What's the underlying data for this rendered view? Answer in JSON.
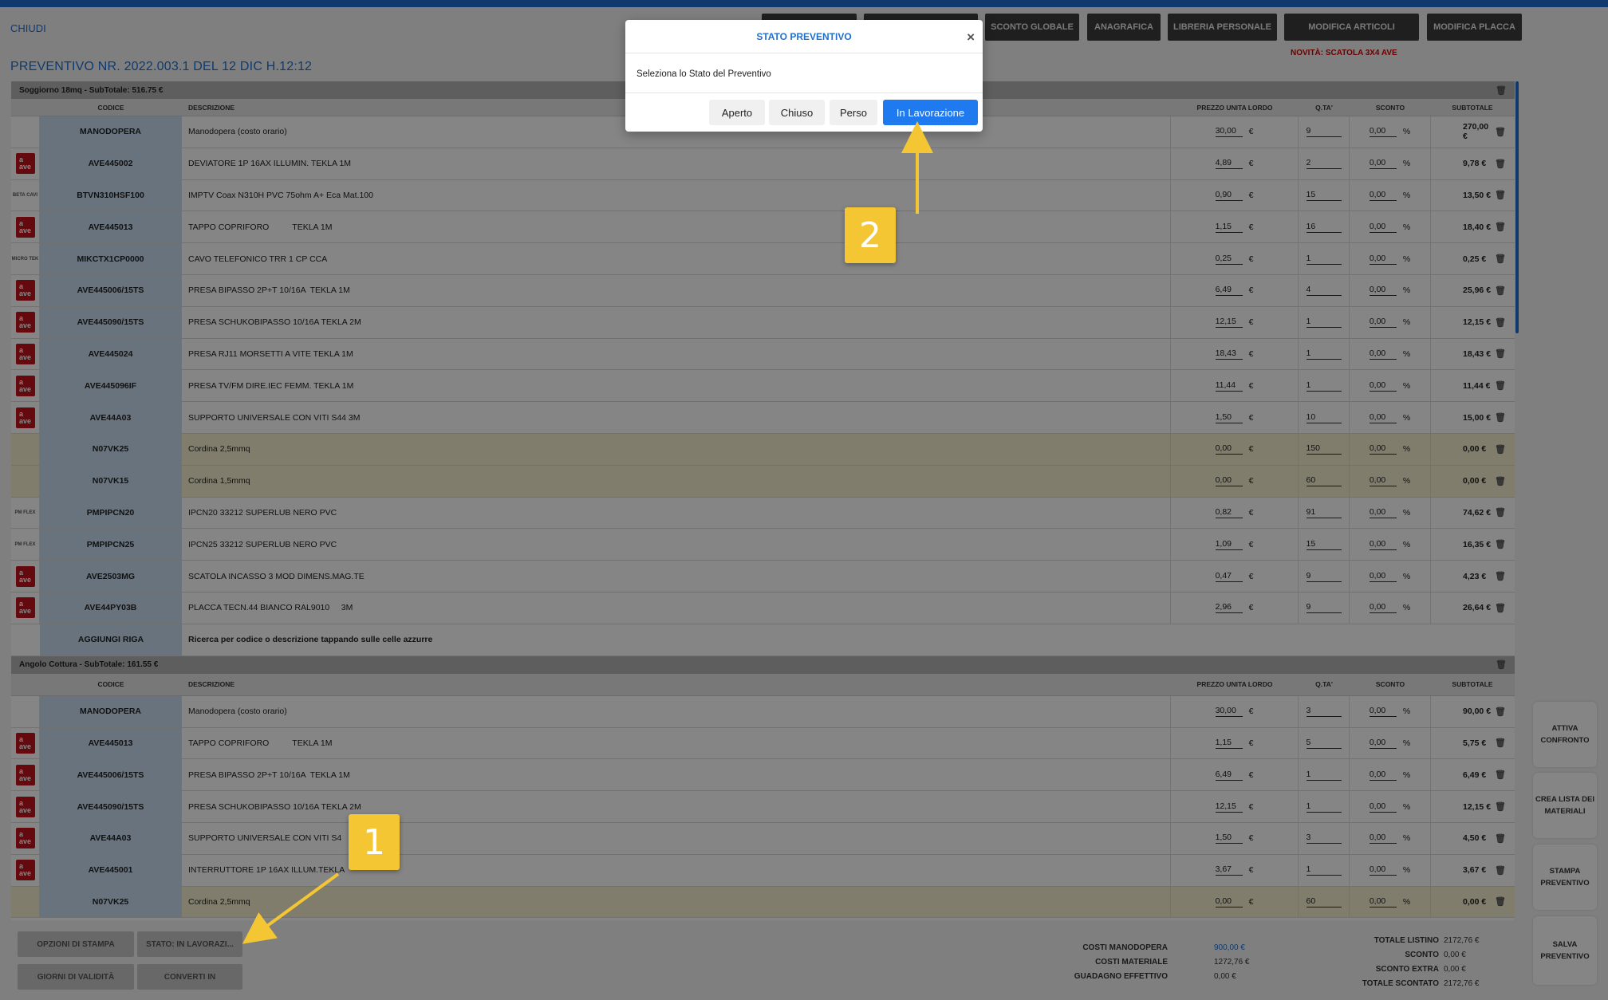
{
  "header": {
    "close_label": "CHIUDI",
    "title": "PREVENTIVO NR. 2022.003.1 DEL 12 DIC H.12:12",
    "news": "NOVITÀ: SCATOLA 3X4 AVE",
    "toolbar": [
      "",
      "",
      "SCONTO GLOBALE",
      "ANAGRAFICA",
      "LIBRERIA PERSONALE",
      "MODIFICA ARTICOLI",
      "MODIFICA PLACCA"
    ]
  },
  "columns": [
    "CODICE",
    "DESCRIZIONE",
    "PREZZO UNITA LORDO",
    "Q.TA'",
    "SCONTO",
    "SUBTOTALE"
  ],
  "currency": "€",
  "percent": "%",
  "sections": [
    {
      "title": "Soggiorno 18mq - SubTotale: 516.75 €",
      "rows": [
        {
          "brand": "",
          "code": "MANODOPERA",
          "desc": "Manodopera (costo orario)",
          "price": "30,00",
          "qty": "9",
          "disc": "0,00",
          "sub": "270,00 €",
          "hl": false
        },
        {
          "brand": "ave",
          "code": "AVE445002",
          "desc": "DEVIATORE 1P 16AX ILLUMIN. TEKLA 1M",
          "price": "4,89",
          "qty": "2",
          "disc": "0,00",
          "sub": "9,78 €",
          "hl": false
        },
        {
          "brand": "BETA CAVI",
          "code": "BTVN310HSF100",
          "desc": "IMPTV Coax N310H PVC 75ohm A+ Eca Mat.100",
          "price": "0,90",
          "qty": "15",
          "disc": "0,00",
          "sub": "13,50 €",
          "hl": false
        },
        {
          "brand": "ave",
          "code": "AVE445013",
          "desc": "TAPPO COPRIFORO          TEKLA 1M",
          "price": "1,15",
          "qty": "16",
          "disc": "0,00",
          "sub": "18,40 €",
          "hl": false
        },
        {
          "brand": "MICRO TEK",
          "code": "MIKCTX1CP0000",
          "desc": "CAVO TELEFONICO TRR 1 CP CCA",
          "price": "0,25",
          "qty": "1",
          "disc": "0,00",
          "sub": "0,25 €",
          "hl": false
        },
        {
          "brand": "ave",
          "code": "AVE445006/15TS",
          "desc": "PRESA BIPASSO 2P+T 10/16A  TEKLA 1M",
          "price": "6,49",
          "qty": "4",
          "disc": "0,00",
          "sub": "25,96 €",
          "hl": false
        },
        {
          "brand": "ave",
          "code": "AVE445090/15TS",
          "desc": "PRESA SCHUKOBIPASSO 10/16A TEKLA 2M",
          "price": "12,15",
          "qty": "1",
          "disc": "0,00",
          "sub": "12,15 €",
          "hl": false
        },
        {
          "brand": "ave",
          "code": "AVE445024",
          "desc": "PRESA RJ11 MORSETTI A VITE TEKLA 1M",
          "price": "18,43",
          "qty": "1",
          "disc": "0,00",
          "sub": "18,43 €",
          "hl": false
        },
        {
          "brand": "ave",
          "code": "AVE445096IF",
          "desc": "PRESA TV/FM DIRE.IEC FEMM. TEKLA 1M",
          "price": "11,44",
          "qty": "1",
          "disc": "0,00",
          "sub": "11,44 €",
          "hl": false
        },
        {
          "brand": "ave",
          "code": "AVE44A03",
          "desc": "SUPPORTO UNIVERSALE CON VITI S44 3M",
          "price": "1,50",
          "qty": "10",
          "disc": "0,00",
          "sub": "15,00 €",
          "hl": false
        },
        {
          "brand": "",
          "code": "N07VK25",
          "desc": "Cordina 2,5mmq",
          "price": "0,00",
          "qty": "150",
          "disc": "0,00",
          "sub": "0,00 €",
          "hl": true
        },
        {
          "brand": "",
          "code": "N07VK15",
          "desc": "Cordina 1,5mmq",
          "price": "0,00",
          "qty": "60",
          "disc": "0,00",
          "sub": "0,00 €",
          "hl": true
        },
        {
          "brand": "PM FLEX",
          "code": "PMPIPCN20",
          "desc": "IPCN20 33212 SUPERLUB NERO PVC",
          "price": "0,82",
          "qty": "91",
          "disc": "0,00",
          "sub": "74,62 €",
          "hl": false
        },
        {
          "brand": "PM FLEX",
          "code": "PMPIPCN25",
          "desc": "IPCN25 33212 SUPERLUB NERO PVC",
          "price": "1,09",
          "qty": "15",
          "disc": "0,00",
          "sub": "16,35 €",
          "hl": false
        },
        {
          "brand": "ave",
          "code": "AVE2503MG",
          "desc": "SCATOLA INCASSO 3 MOD DIMENS.MAG.TE",
          "price": "0,47",
          "qty": "9",
          "disc": "0,00",
          "sub": "4,23 €",
          "hl": false
        },
        {
          "brand": "ave",
          "code": "AVE44PY03B",
          "desc": "PLACCA TECN.44 BIANCO RAL9010     3M",
          "price": "2,96",
          "qty": "9",
          "disc": "0,00",
          "sub": "26,64 €",
          "hl": false
        }
      ],
      "add_row": {
        "code": "AGGIUNGI RIGA",
        "desc": "Ricerca per codice o descrizione tappando sulle celle azzurre"
      }
    },
    {
      "title": "Angolo Cottura - SubTotale: 161.55 €",
      "rows": [
        {
          "brand": "",
          "code": "MANODOPERA",
          "desc": "Manodopera (costo orario)",
          "price": "30,00",
          "qty": "3",
          "disc": "0,00",
          "sub": "90,00 €",
          "hl": false
        },
        {
          "brand": "ave",
          "code": "AVE445013",
          "desc": "TAPPO COPRIFORO          TEKLA 1M",
          "price": "1,15",
          "qty": "5",
          "disc": "0,00",
          "sub": "5,75 €",
          "hl": false
        },
        {
          "brand": "ave",
          "code": "AVE445006/15TS",
          "desc": "PRESA BIPASSO 2P+T 10/16A  TEKLA 1M",
          "price": "6,49",
          "qty": "1",
          "disc": "0,00",
          "sub": "6,49 €",
          "hl": false
        },
        {
          "brand": "ave",
          "code": "AVE445090/15TS",
          "desc": "PRESA SCHUKOBIPASSO 10/16A TEKLA 2M",
          "price": "12,15",
          "qty": "1",
          "disc": "0,00",
          "sub": "12,15 €",
          "hl": false
        },
        {
          "brand": "ave",
          "code": "AVE44A03",
          "desc": "SUPPORTO UNIVERSALE CON VITI S4",
          "price": "1,50",
          "qty": "3",
          "disc": "0,00",
          "sub": "4,50 €",
          "hl": false
        },
        {
          "brand": "ave",
          "code": "AVE445001",
          "desc": "INTERRUTTORE 1P 16AX ILLUM.TEKLA",
          "price": "3,67",
          "qty": "1",
          "disc": "0,00",
          "sub": "3,67 €",
          "hl": false
        },
        {
          "brand": "",
          "code": "N07VK25",
          "desc": "Cordina 2,5mmq",
          "price": "0,00",
          "qty": "60",
          "disc": "0,00",
          "sub": "0,00 €",
          "hl": true
        }
      ]
    }
  ],
  "bottom": {
    "print_options": "OPZIONI DI STAMPA",
    "status_button": "STATO: IN LAVORAZI...",
    "validity_days": "GIORNI DI VALIDITÀ",
    "convert_to": "CONVERTI IN",
    "labor_cost_label": "COSTI MANODOPERA",
    "labor_cost_value": "900,00 €",
    "material_cost_label": "COSTI MATERIALE",
    "material_cost_value": "1272,76 €",
    "profit_label": "GUADAGNO EFFETTIVO",
    "profit_value": "0,00 €",
    "list_total_label": "TOTALE LISTINO",
    "list_total_value": "2172,76 €",
    "discount_label": "SCONTO",
    "discount_value": "0,00 €",
    "extra_discount_label": "SCONTO EXTRA",
    "extra_discount_value": "0,00 €",
    "discounted_total_label": "TOTALE SCONTATO",
    "discounted_total_value": "2172,76 €"
  },
  "side": {
    "compare": "ATTIVA CONFRONTO",
    "materials_list": "CREA LISTA DEI MATERIALI",
    "print_quote": "STAMPA PREVENTIVO",
    "save_quote": "SALVA PREVENTIVO"
  },
  "modal": {
    "title": "STATO PREVENTIVO",
    "close": "×",
    "body": "Seleziona lo Stato del Preventivo",
    "options": [
      "Aperto",
      "Chiuso",
      "Perso",
      "In Lavorazione"
    ]
  },
  "callouts": [
    "1",
    "2"
  ],
  "colors": {
    "accent": "#1f6fd1",
    "callout": "#f4c634",
    "highlight_row": "#f5f0cf",
    "code_cell": "#c9dcf0"
  }
}
